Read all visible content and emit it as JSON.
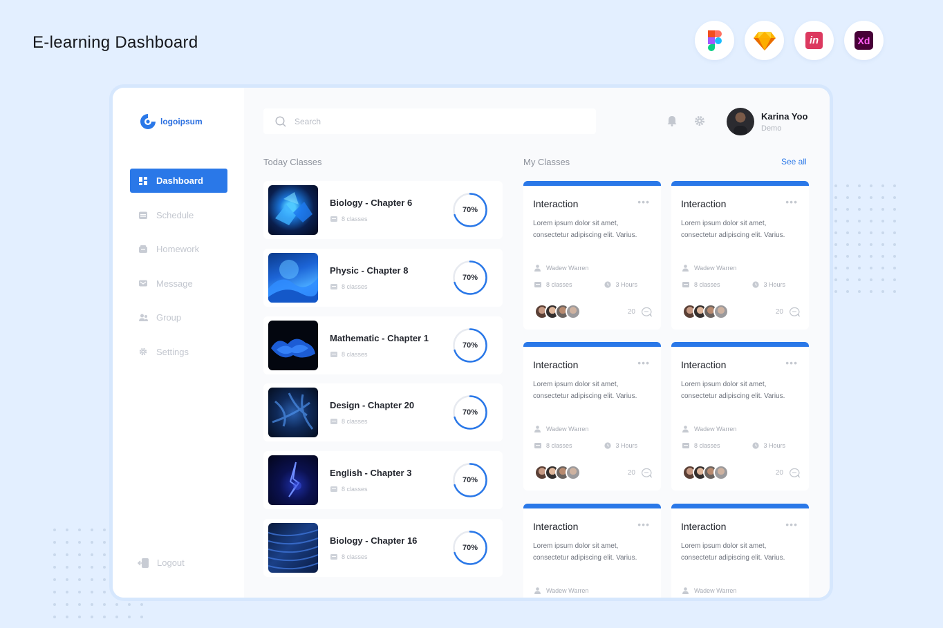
{
  "showcase": {
    "title": "E-learning Dashboard",
    "tools": [
      {
        "name": "figma",
        "icon": "figma-icon"
      },
      {
        "name": "sketch",
        "icon": "sketch-icon"
      },
      {
        "name": "invision",
        "icon": "invision-icon",
        "label": "in"
      },
      {
        "name": "adobe-xd",
        "icon": "adobe-xd-icon",
        "label": "Xd"
      }
    ]
  },
  "brand": {
    "logo_text": "logoipsum",
    "accent": "#2a78e8"
  },
  "sidebar": {
    "items": [
      {
        "label": "Dashboard",
        "icon": "grid-icon",
        "active": true
      },
      {
        "label": "Schedule",
        "icon": "calendar-icon"
      },
      {
        "label": "Homework",
        "icon": "inbox-icon"
      },
      {
        "label": "Message",
        "icon": "mail-icon"
      },
      {
        "label": "Group",
        "icon": "users-icon"
      },
      {
        "label": "Settings",
        "icon": "gear-icon"
      }
    ],
    "logout_label": "Logout"
  },
  "header": {
    "search_placeholder": "Search",
    "user": {
      "name": "Karina Yoo",
      "role": "Demo"
    }
  },
  "today": {
    "title": "Today Classes",
    "classes": [
      {
        "title": "Biology - Chapter 6",
        "sub": "8 classes",
        "progress": "70%"
      },
      {
        "title": "Physic - Chapter 8",
        "sub": "8 classes",
        "progress": "70%"
      },
      {
        "title": "Mathematic - Chapter 1",
        "sub": "8 classes",
        "progress": "70%"
      },
      {
        "title": "Design - Chapter 20",
        "sub": "8 classes",
        "progress": "70%"
      },
      {
        "title": "English - Chapter 3",
        "sub": "8 classes",
        "progress": "70%"
      },
      {
        "title": "Biology - Chapter 16",
        "sub": "8 classes",
        "progress": "70%"
      }
    ]
  },
  "my_classes": {
    "title": "My Classes",
    "see_all": "See all",
    "cards": [
      {
        "title": "Interaction",
        "desc": "Lorem ipsum dolor sit amet, consectetur adipiscing elit. Varius.",
        "author": "Wadew Warren",
        "classes": "8 classes",
        "hours": "3 Hours",
        "comments": "20"
      },
      {
        "title": "Interaction",
        "desc": "Lorem ipsum dolor sit amet, consectetur adipiscing elit. Varius.",
        "author": "Wadew Warren",
        "classes": "8 classes",
        "hours": "3 Hours",
        "comments": "20"
      },
      {
        "title": "Interaction",
        "desc": "Lorem ipsum dolor sit amet, consectetur adipiscing elit. Varius.",
        "author": "Wadew Warren",
        "classes": "8 classes",
        "hours": "3 Hours",
        "comments": "20"
      },
      {
        "title": "Interaction",
        "desc": "Lorem ipsum dolor sit amet, consectetur adipiscing elit. Varius.",
        "author": "Wadew Warren",
        "classes": "8 classes",
        "hours": "3 Hours",
        "comments": "20"
      },
      {
        "title": "Interaction",
        "desc": "Lorem ipsum dolor sit amet, consectetur adipiscing elit. Varius.",
        "author": "Wadew Warren"
      },
      {
        "title": "Interaction",
        "desc": "Lorem ipsum dolor sit amet, consectetur adipiscing elit. Varius.",
        "author": "Wadew Warren"
      }
    ]
  }
}
